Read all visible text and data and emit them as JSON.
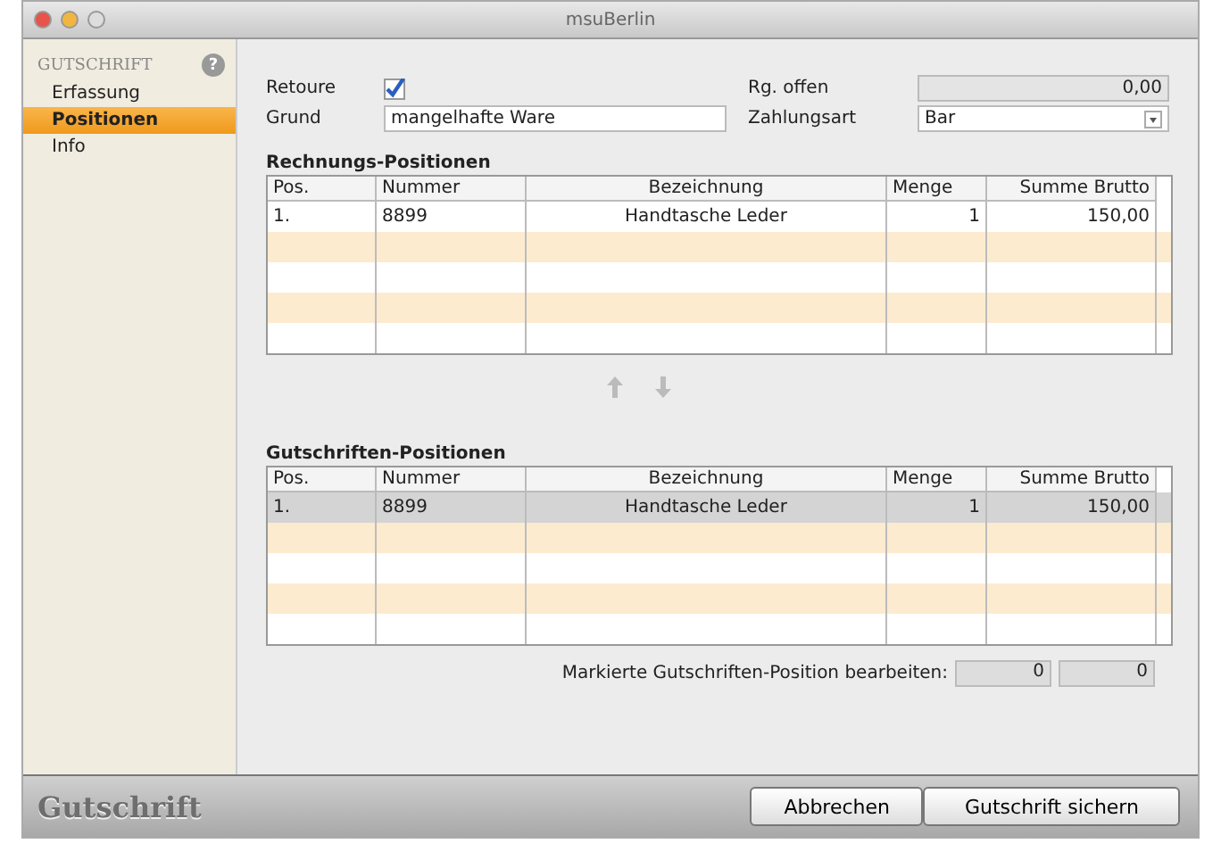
{
  "window": {
    "title": "msuBerlin"
  },
  "sidebar": {
    "heading": "GUTSCHRIFT",
    "help": "?",
    "items": [
      {
        "label": "Erfassung",
        "selected": false
      },
      {
        "label": "Positionen",
        "selected": true
      },
      {
        "label": "Info",
        "selected": false
      }
    ]
  },
  "form": {
    "retoure": {
      "label": "Retoure",
      "checked": true
    },
    "grund": {
      "label": "Grund",
      "value": "mangelhafte Ware"
    },
    "rg_offen": {
      "label": "Rg. offen",
      "value": "0,00"
    },
    "zahlungsart": {
      "label": "Zahlungsart",
      "value": "Bar"
    }
  },
  "tables": [
    {
      "title": "Rechnungs-Positionen",
      "columns": [
        "Pos.",
        "Nummer",
        "Bezeichnung",
        "Menge",
        "Summe Brutto"
      ],
      "rows": [
        {
          "cells": [
            "1.",
            "8899",
            "Handtasche Leder",
            "1",
            "150,00"
          ],
          "selected": false
        }
      ]
    },
    {
      "title": "Gutschriften-Positionen",
      "columns": [
        "Pos.",
        "Nummer",
        "Bezeichnung",
        "Menge",
        "Summe Brutto"
      ],
      "rows": [
        {
          "cells": [
            "1.",
            "8899",
            "Handtasche Leder",
            "1",
            "150,00"
          ],
          "selected": true
        }
      ]
    }
  ],
  "edit_row": {
    "label": "Markierte Gutschriften-Position bearbeiten:",
    "values": [
      "0",
      "0"
    ]
  },
  "footer": {
    "title": "Gutschrift",
    "buttons": [
      "Abbrechen",
      "Gutschrift sichern"
    ]
  }
}
